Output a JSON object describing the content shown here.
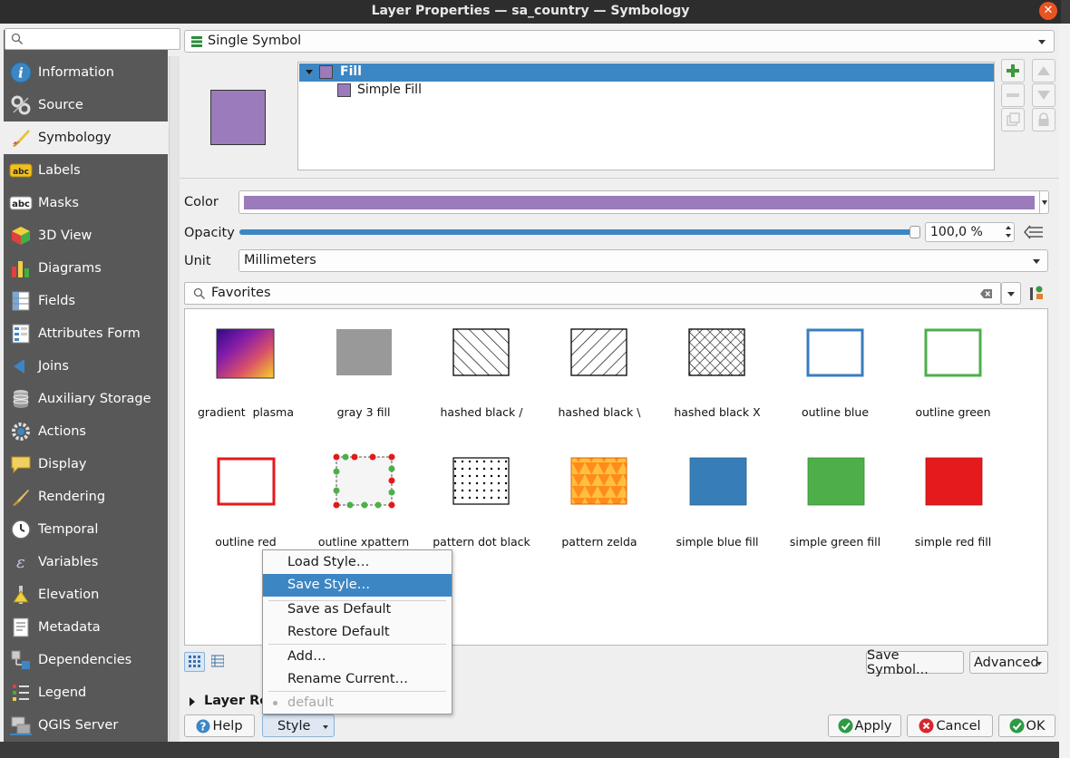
{
  "window": {
    "title": "Layer Properties — sa_country — Symbology"
  },
  "sidebar": {
    "items": [
      {
        "label": "Information",
        "icon": "info-icon"
      },
      {
        "label": "Source",
        "icon": "source-icon"
      },
      {
        "label": "Symbology",
        "icon": "symbology-icon",
        "active": true
      },
      {
        "label": "Labels",
        "icon": "labels-icon"
      },
      {
        "label": "Masks",
        "icon": "masks-icon"
      },
      {
        "label": "3D View",
        "icon": "cube-icon"
      },
      {
        "label": "Diagrams",
        "icon": "diagrams-icon"
      },
      {
        "label": "Fields",
        "icon": "fields-icon"
      },
      {
        "label": "Attributes Form",
        "icon": "form-icon"
      },
      {
        "label": "Joins",
        "icon": "joins-icon"
      },
      {
        "label": "Auxiliary Storage",
        "icon": "database-icon"
      },
      {
        "label": "Actions",
        "icon": "gear-icon"
      },
      {
        "label": "Display",
        "icon": "speech-bubble-icon"
      },
      {
        "label": "Rendering",
        "icon": "brush-icon"
      },
      {
        "label": "Temporal",
        "icon": "clock-icon"
      },
      {
        "label": "Variables",
        "icon": "variables-icon"
      },
      {
        "label": "Elevation",
        "icon": "elevation-icon"
      },
      {
        "label": "Metadata",
        "icon": "metadata-icon"
      },
      {
        "label": "Dependencies",
        "icon": "dependencies-icon"
      },
      {
        "label": "Legend",
        "icon": "legend-icon"
      },
      {
        "label": "QGIS Server",
        "icon": "server-icon"
      }
    ]
  },
  "renderer": {
    "value": "Single Symbol"
  },
  "symbol_tree": {
    "root": "Fill",
    "child": "Simple Fill"
  },
  "colors": {
    "fill": "#9b7bbb",
    "accent": "#3d86c4"
  },
  "props": {
    "color_label": "Color",
    "opacity_label": "Opacity",
    "opacity_value": "100,0 %",
    "opacity_fraction": 1.0,
    "unit_label": "Unit",
    "unit_value": "Millimeters"
  },
  "library": {
    "search_value": "Favorites",
    "symbols": [
      {
        "name": "gradient  plasma"
      },
      {
        "name": "gray 3 fill"
      },
      {
        "name": "hashed black /"
      },
      {
        "name": "hashed black \\"
      },
      {
        "name": "hashed black X"
      },
      {
        "name": "outline blue"
      },
      {
        "name": "outline green"
      },
      {
        "name": "outline red"
      },
      {
        "name": "outline xpattern"
      },
      {
        "name": "pattern dot black"
      },
      {
        "name": "pattern zelda"
      },
      {
        "name": "simple blue fill"
      },
      {
        "name": "simple green fill"
      },
      {
        "name": "simple red fill"
      }
    ]
  },
  "buttons": {
    "save_symbol": "Save Symbol...",
    "advanced": "Advanced",
    "help": "Help",
    "style": "Style",
    "apply": "Apply",
    "cancel": "Cancel",
    "ok": "OK"
  },
  "layer_rendering": {
    "label": "Layer Re"
  },
  "style_menu": {
    "items": [
      "Load Style…",
      "Save Style…",
      "Save as Default",
      "Restore Default",
      "Add…",
      "Rename Current…",
      "default"
    ]
  }
}
